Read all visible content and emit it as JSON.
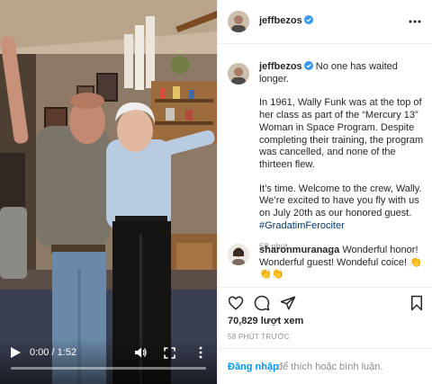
{
  "post": {
    "username": "jeffbezos",
    "verified": true,
    "caption": {
      "headline": "No one has waited longer.",
      "paragraph_1": "In 1961, Wally Funk was at the top of her class as part of the “Mercury 13” Woman in Space Program. Despite completing their training, the program was cancelled, and none of the thirteen flew.",
      "paragraph_2": "It’s time. Welcome to the crew, Wally. We’re excited to have you fly with us on July 20th as our honored guest.",
      "hashtag": "#GradatimFerociter",
      "time": "58 phút"
    },
    "comment": {
      "username": "sharonmuranaga",
      "text": "Wonderful honor! Wonderful guest! Wondeful coice! 👏👏👏"
    },
    "views": "70,829 lượt xem",
    "posted": "58 PHÚT TRƯỚC",
    "login": {
      "link": "Đăng nhập",
      "rest": "để thích hoặc bình luận."
    }
  },
  "video": {
    "time": "0:00 / 1:52",
    "progress": 0
  },
  "icons": {
    "header_more": "more-dots-icon",
    "like": "heart-icon",
    "comment": "comment-bubble-icon",
    "share": "paper-plane-icon",
    "save": "bookmark-icon",
    "play": "play-icon",
    "volume": "volume-icon",
    "fullscreen": "fullscreen-icon",
    "video_more": "vertical-dots-icon"
  },
  "colors": {
    "link": "#0095f6",
    "hashtag": "#00376b",
    "verified": "#3897f0",
    "muted": "#8e8e8e"
  }
}
